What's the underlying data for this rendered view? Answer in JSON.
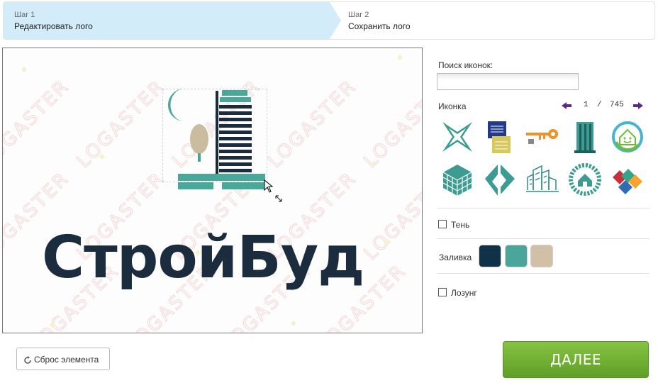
{
  "steps": [
    {
      "number": "Шаг 1",
      "title": "Редактировать лого"
    },
    {
      "number": "Шаг 2",
      "title": "Сохранить лого"
    }
  ],
  "canvas": {
    "logo_text": "СтройБуд",
    "watermark": "LOGASTER",
    "colors": {
      "dark": "#1b2c3f",
      "teal": "#48a89a",
      "beige": "#cbbb9f"
    }
  },
  "panel": {
    "search_label": "Поиск иконок:",
    "search_value": "",
    "icon_label": "Иконка",
    "pager": {
      "current": "1",
      "separator": "/",
      "total": "745"
    },
    "icons": [
      "x-star-icon",
      "building-card-icon",
      "key-icon",
      "tower-icon",
      "eco-house-icon",
      "cube-icon",
      "arrow-blocks-icon",
      "city-sketch-icon",
      "house-circle-icon",
      "diamond-blocks-icon"
    ],
    "shadow_label": "Тень",
    "fill_label": "Заливка",
    "fill_colors": [
      "#0f3248",
      "#4aa69a",
      "#cfc0a7"
    ],
    "slogan_label": "Лозунг"
  },
  "buttons": {
    "reset_label": "Сброс элемента",
    "next_label": "ДАЛЕЕ"
  }
}
